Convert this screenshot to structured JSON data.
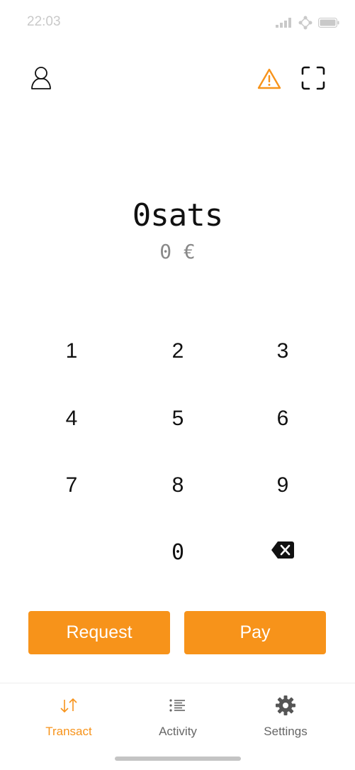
{
  "status_bar": {
    "time": "22:03",
    "signal_icon": "signal-bars-icon",
    "network_icon": "network-nodes-icon",
    "battery_icon": "battery-icon"
  },
  "header": {
    "profile_icon": "user-icon",
    "warning_icon": "warning-triangle-icon",
    "scan_icon": "scan-frame-icon"
  },
  "amount": {
    "primary": "0sats",
    "fiat": "0 €"
  },
  "keypad": {
    "keys": [
      "1",
      "2",
      "3",
      "4",
      "5",
      "6",
      "7",
      "8",
      "9",
      "0"
    ],
    "backspace_icon": "backspace-icon"
  },
  "actions": {
    "request_label": "Request",
    "pay_label": "Pay"
  },
  "tabs": [
    {
      "label": "Transact",
      "icon": "transfer-arrows-icon",
      "active": true
    },
    {
      "label": "Activity",
      "icon": "list-icon",
      "active": false
    },
    {
      "label": "Settings",
      "icon": "gear-icon",
      "active": false
    }
  ],
  "colors": {
    "accent": "#f7931a",
    "text": "#111111",
    "muted": "#888888"
  }
}
